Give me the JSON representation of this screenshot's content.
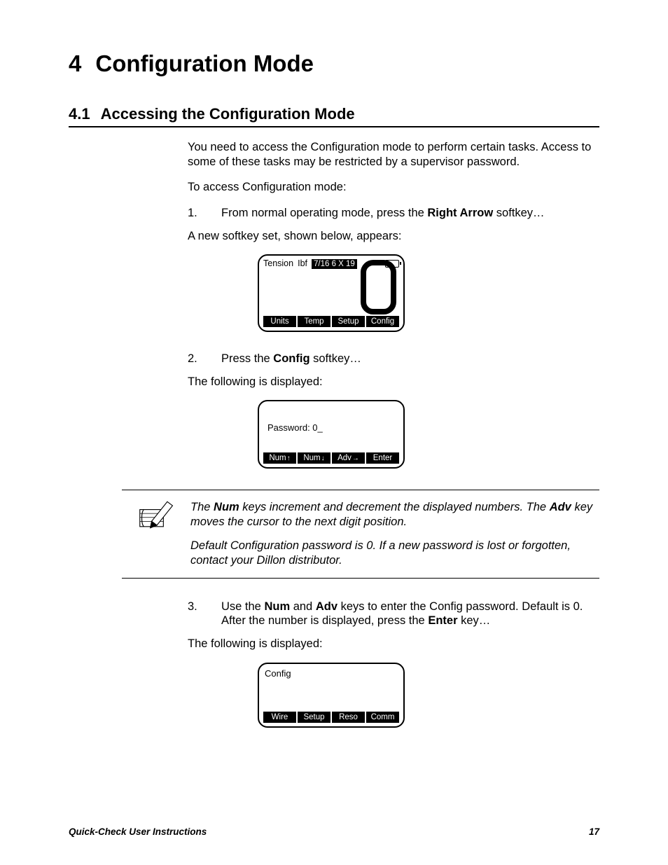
{
  "chapter": {
    "num": "4",
    "title": "Configuration Mode"
  },
  "section": {
    "num": "4.1",
    "title": "Accessing the Configuration Mode"
  },
  "intro": {
    "p1": "You need to access the Configuration mode to perform certain tasks. Access to some of these tasks may be restricted by a supervisor password.",
    "p2": "To access Configuration mode:"
  },
  "steps": {
    "s1": {
      "num": "1.",
      "text_pre": "From normal operating mode, press the ",
      "bold": "Right Arrow",
      "text_post": " softkey…",
      "sub": "A new softkey set, shown below, appears:"
    },
    "s2": {
      "num": "2.",
      "text_pre": "Press the ",
      "bold": "Config",
      "text_post": " softkey…",
      "sub": "The following is displayed:"
    },
    "s3": {
      "num": "3.",
      "t_a": "Use the ",
      "b_a": "Num",
      "t_b": " and ",
      "b_b": "Adv",
      "t_c": " keys to enter the Config password. Default is 0. After the number is displayed, press the ",
      "b_c": "Enter",
      "t_d": " key…",
      "sub": "The following is displayed:"
    }
  },
  "lcd1": {
    "label1": "Tension",
    "label2": "Ibf",
    "rope": "7/16 6 X 19",
    "sk1": "Units",
    "sk2": "Temp",
    "sk3": "Setup",
    "sk4": "Config"
  },
  "lcd2": {
    "pw": "Password: 0_",
    "sk1": "Num",
    "sk2": "Num",
    "sk3": "Adv",
    "sk4": "Enter"
  },
  "lcd3": {
    "title": "Config",
    "sk1": "Wire",
    "sk2": "Setup",
    "sk3": "Reso",
    "sk4": "Comm"
  },
  "note": {
    "p1a": "The ",
    "p1b": "Num",
    "p1c": " keys increment and decrement the displayed numbers. The ",
    "p1d": "Adv",
    "p1e": " key moves the cursor to the next digit position.",
    "p2": "Default Configuration password is 0. If a new password is lost or forgotten, contact your Dillon distributor."
  },
  "footer": {
    "left": "Quick-Check User Instructions",
    "right": "17"
  }
}
